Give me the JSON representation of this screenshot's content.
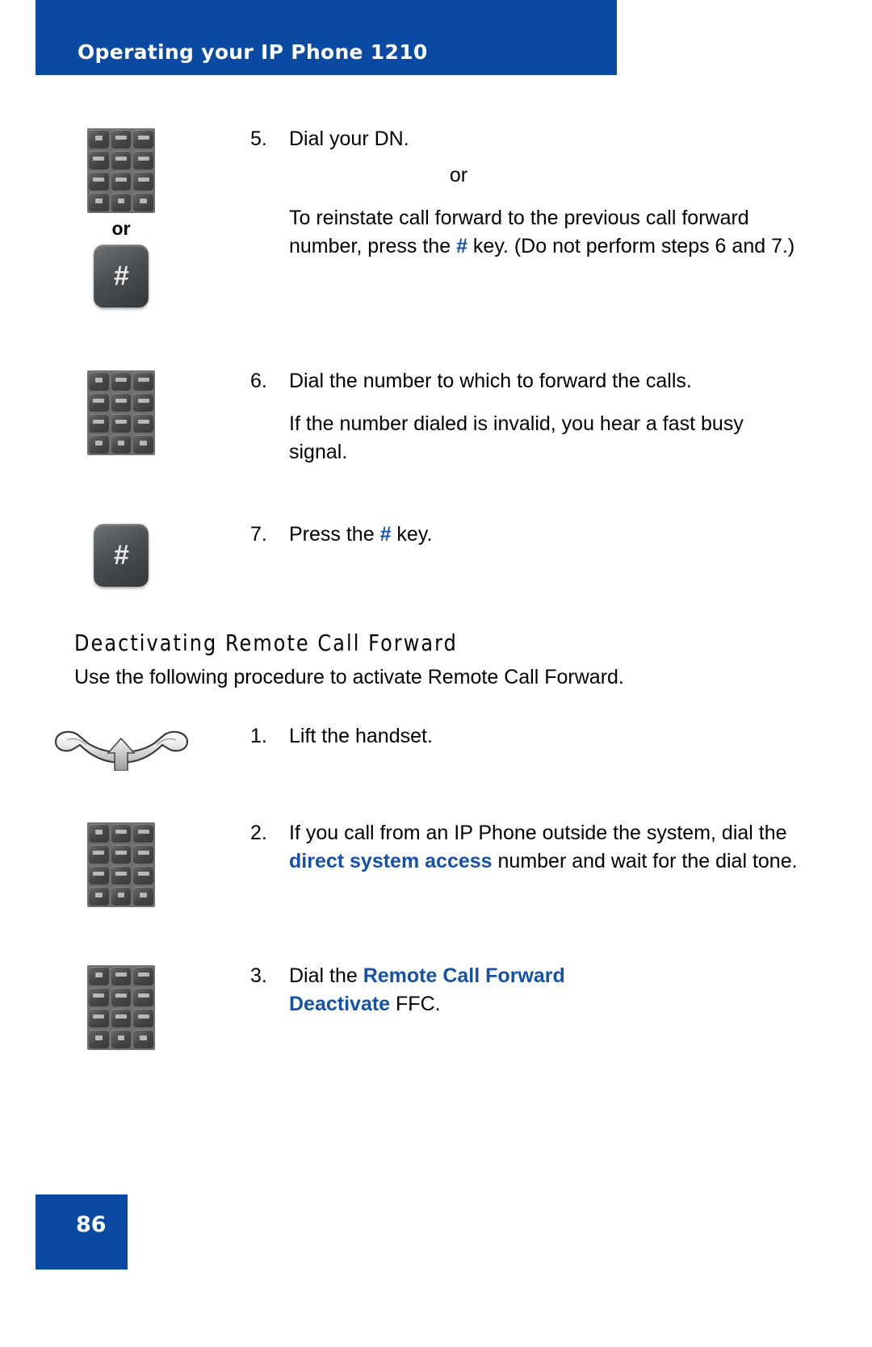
{
  "header": {
    "title": "Operating your IP Phone 1210",
    "banner_color": "#0b4aa2"
  },
  "footer": {
    "page_number": "86",
    "box_color": "#0b4aa2"
  },
  "accent_color": "#1551a8",
  "steps_top": {
    "step5": {
      "number": "5.",
      "text": "Dial your DN.",
      "or_label": "or",
      "alt_text_part1": "To reinstate call forward to the previous call forward number, press the ",
      "alt_text_hash": "#",
      "alt_text_part2": " key. (Do not perform steps 6 and 7.)"
    },
    "icon_or_label": "or",
    "step6": {
      "number": "6.",
      "text": "Dial the number to which to forward the calls.",
      "sub_text": "If the number dialed is invalid, you hear a fast busy signal."
    },
    "step7": {
      "number": "7.",
      "text_part1": "Press the ",
      "text_hash": "#",
      "text_part2": " key."
    }
  },
  "section": {
    "heading": "Deactivating Remote Call Forward",
    "intro": "Use the following procedure to activate Remote Call Forward."
  },
  "steps_bottom": {
    "step1": {
      "number": "1.",
      "text": "Lift the handset."
    },
    "step2": {
      "number": "2.",
      "text_part1": "If you call from an IP Phone outside the system, dial the ",
      "text_highlight": "direct system access",
      "text_part2": " number and wait for the dial tone."
    },
    "step3": {
      "number": "3.",
      "text_part1": "Dial the ",
      "text_highlight": "Remote Call Forward Deactivate",
      "text_part2": " FFC."
    }
  },
  "icons": {
    "keypad": "keypad-icon",
    "hash_key": "hash-key-icon",
    "handset": "handset-lift-icon"
  }
}
